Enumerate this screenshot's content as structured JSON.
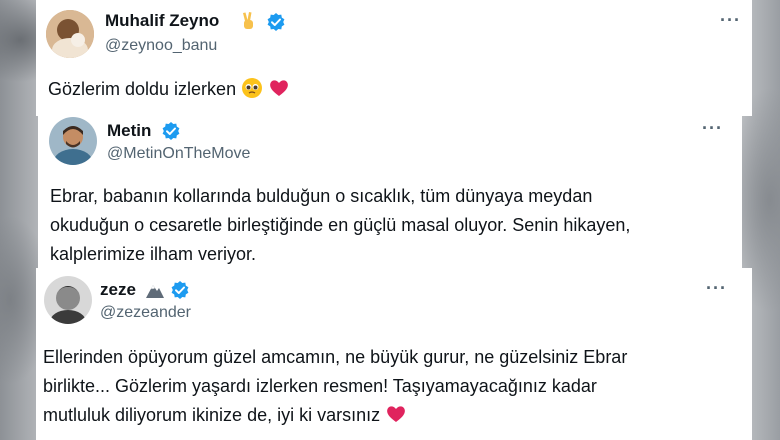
{
  "tweets": [
    {
      "name": "Muhalif Zeyno",
      "handle": "@zeynoo_banu",
      "name_emoji": "victory-hand-emoji",
      "verified": true,
      "more_label": "···",
      "lines": [
        "Gözlerim doldu izlerken"
      ],
      "trailing_emojis": [
        "pleading-face-emoji",
        "red-heart-emoji"
      ]
    },
    {
      "name": "Metin",
      "handle": "@MetinOnTheMove",
      "verified": true,
      "more_label": "···",
      "lines": [
        "Ebrar, babanın kollarında bulduğun o sıcaklık, tüm dünyaya meydan",
        "okuduğun o cesaretle birleştiğinde en güçlü masal oluyor. Senin hikayen,",
        "kalplerimize ilham veriyor."
      ]
    },
    {
      "name": "zeze",
      "handle": "@zezeander",
      "name_emoji": "snow-mountain-emoji",
      "verified": true,
      "more_label": "···",
      "lines": [
        "Ellerinden öpüyorum güzel amcamın, ne büyük gurur, ne güzelsiniz Ebrar",
        "birlikte... Gözlerim yaşardı izlerken resmen! Taşıyamayacağınız kadar",
        "mutluluk diliyorum ikinize de, iyi ki varsınız"
      ],
      "trailing_emojis": [
        "red-heart-emoji"
      ]
    }
  ],
  "colors": {
    "verified_blue": "#1d9bf0",
    "handle_gray": "#536471",
    "heart_red": "#e0245e"
  }
}
